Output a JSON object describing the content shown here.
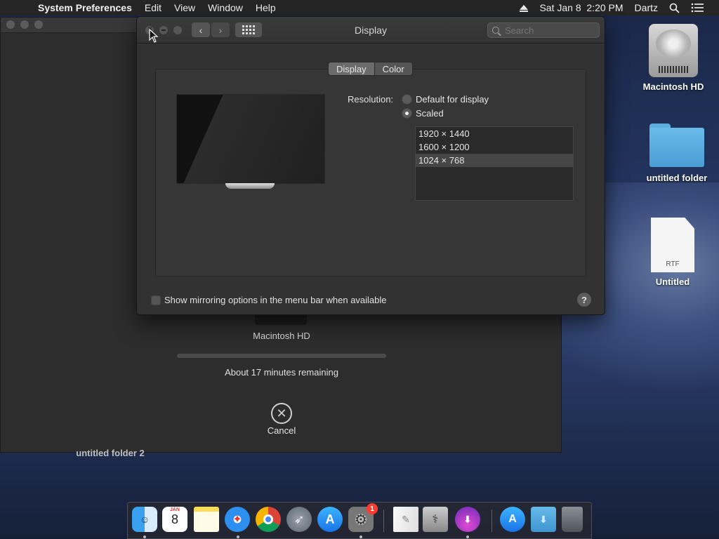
{
  "menubar": {
    "app_name": "System Preferences",
    "menus": [
      "Edit",
      "View",
      "Window",
      "Help"
    ],
    "datetime": "Sat Jan 8  2:20 PM",
    "user": "Dartz"
  },
  "installer": {
    "disk_name": "Macintosh HD",
    "progress_fraction": 0.0,
    "remaining": "About 17 minutes remaining",
    "cancel_label": "Cancel",
    "partially_hidden_icon_label": "untitled folder 2"
  },
  "prefs": {
    "title": "Display",
    "search_placeholder": "Search",
    "tabs": [
      {
        "label": "Display",
        "active": true
      },
      {
        "label": "Color",
        "active": false
      }
    ],
    "resolution_label": "Resolution:",
    "resolution_options": [
      {
        "label": "Default for display",
        "selected": false
      },
      {
        "label": "Scaled",
        "selected": true
      }
    ],
    "scaled_resolutions": [
      {
        "label": "1920 × 1440",
        "selected": false
      },
      {
        "label": "1600 × 1200",
        "selected": false
      },
      {
        "label": "1024 × 768",
        "selected": true
      }
    ],
    "mirroring_label": "Show mirroring options in the menu bar when available",
    "mirroring_checked": false,
    "help_label": "?"
  },
  "desktop_icons": [
    {
      "label": "Macintosh HD",
      "kind": "hard-drive"
    },
    {
      "label": "untitled folder",
      "kind": "folder"
    },
    {
      "label": "Untitled",
      "kind": "rtf-document",
      "badge": "RTF"
    }
  ],
  "dock": {
    "items": [
      {
        "name": "finder",
        "running": true
      },
      {
        "name": "calendar",
        "month": "JAN",
        "day": "8",
        "running": false
      },
      {
        "name": "notes",
        "running": false
      },
      {
        "name": "safari",
        "running": true
      },
      {
        "name": "chrome",
        "running": false
      },
      {
        "name": "launchpad",
        "running": false
      },
      {
        "name": "app-store",
        "running": false
      },
      {
        "name": "system-preferences",
        "badge": "1",
        "running": true
      },
      {
        "name": "textedit",
        "running": false
      },
      {
        "name": "disk-utility",
        "running": false
      },
      {
        "name": "installer",
        "running": true
      },
      {
        "name": "app-store-downloads",
        "running": false
      },
      {
        "name": "downloads-folder",
        "running": false
      },
      {
        "name": "trash",
        "running": false
      }
    ]
  }
}
